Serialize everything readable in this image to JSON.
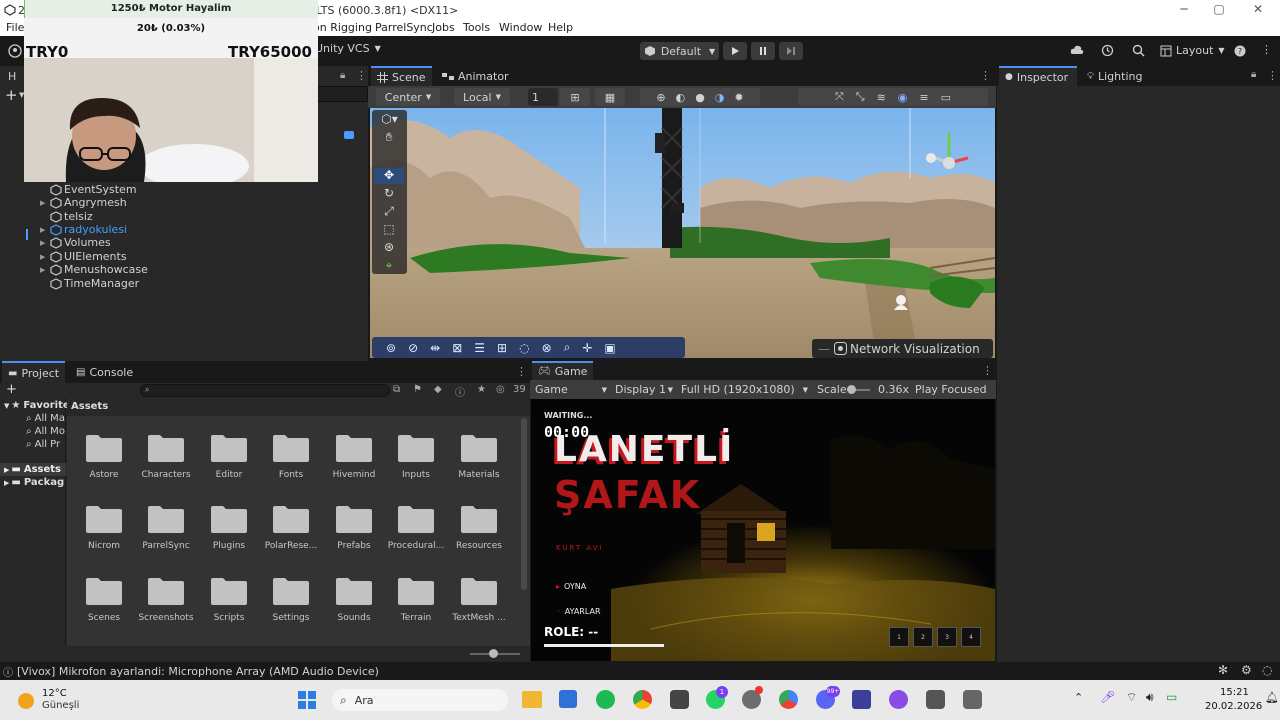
{
  "window": {
    "title": "2ngames - Greybox - Windows, Mac, Linux - Unity 6.3 LTS (6000.3.8f1) <DX11>",
    "minimize": "─",
    "maximize": "▢",
    "close": "✕"
  },
  "menu": {
    "file": "File",
    "animation_rigging": "ion Rigging",
    "parrelsync": "ParrelSync",
    "jobs": "Jobs",
    "tools": "Tools",
    "window": "Window",
    "help": "Help"
  },
  "toolbar": {
    "vcs": "Unity VCS",
    "default": "Default",
    "layout": "Layout"
  },
  "overlay": {
    "title": "1250₺ Motor Hayalim",
    "percent": "20₺ (0.03%)",
    "left_value": "TRY0",
    "right_value": "TRY65000"
  },
  "hierarchy": {
    "items": [
      "EventSystem",
      "Angrymesh",
      "telsiz",
      "radyokulesi",
      "Volumes",
      "UIElements",
      "Menushowcase",
      "TimeManager"
    ]
  },
  "scene": {
    "tab_scene": "Scene",
    "tab_animator": "Animator",
    "pivot": "Center",
    "space": "Local",
    "grid_snap": "1",
    "network_visualization": "Network Visualization"
  },
  "inspector": {
    "tab_inspector": "Inspector",
    "tab_lighting": "Lighting"
  },
  "project": {
    "tab_project": "Project",
    "tab_console": "Console",
    "hidden_count": "39",
    "breadcrumb": "Assets",
    "favorites": "Favorite",
    "fav_items": [
      "All Ma",
      "All Mo",
      "All Pr"
    ],
    "assets": "Assets",
    "packages": "Packag",
    "folders": [
      "Astore",
      "Characters",
      "Editor",
      "Fonts",
      "Hivemind",
      "Inputs",
      "Materials",
      "Nicrom",
      "ParrelSync",
      "Plugins",
      "PolarRese...",
      "Prefabs",
      "Procedural...",
      "Resources",
      "Scenes",
      "Screenshots",
      "Scripts",
      "Settings",
      "Sounds",
      "Terrain",
      "TextMesh ..."
    ]
  },
  "game": {
    "tab_game": "Game",
    "display_mode": "Game",
    "display": "Display 1",
    "resolution": "Full HD (1920x1080)",
    "scale_label": "Scale",
    "scale_value": "0.36x",
    "play_focused": "Play Focused",
    "waiting": "WAITING...",
    "timer": "00:00",
    "title_line1": "LANETLİ",
    "title_line2": "ŞAFAK",
    "subtitle": "KURT AVI",
    "menu_play": "OYNA",
    "menu_settings": "AYARLAR",
    "role": "ROLE: --",
    "slots": [
      "1",
      "2",
      "3",
      "4"
    ]
  },
  "status": {
    "message": "[Vivox] Mikrofon ayarlandi: Microphone Array (AMD Audio Device)"
  },
  "taskbar": {
    "temp": "12°C",
    "weather": "Güneşli",
    "search": "Ara",
    "time": "15:21",
    "date": "20.02.2026",
    "badge_whatsapp": "1",
    "badge_discord": "99+"
  },
  "colors": {
    "accent": "#4c8df6",
    "game_title": "#f2ecec",
    "game_red": "#c4181c",
    "selected_item": "#4a9dff"
  }
}
